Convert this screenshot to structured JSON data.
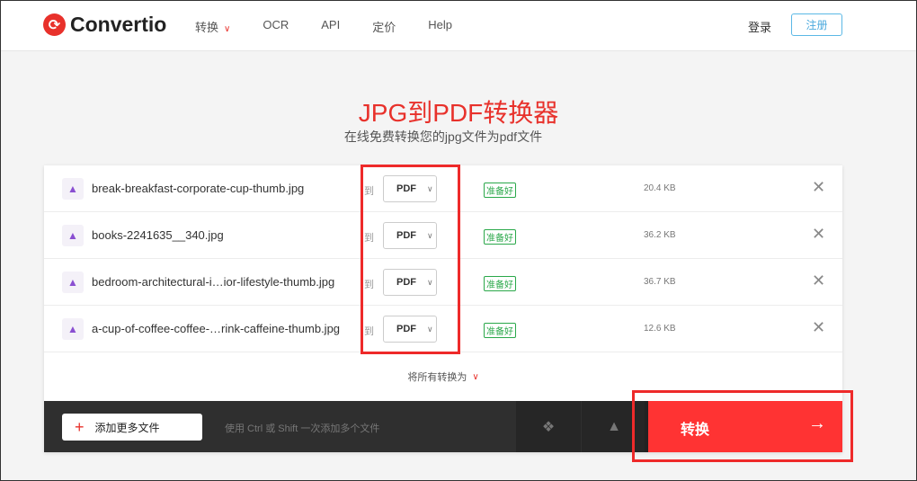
{
  "header": {
    "logo": "Convertio",
    "nav": [
      "转换",
      "OCR",
      "API",
      "定价",
      "Help"
    ],
    "login": "登录",
    "signup": "注册"
  },
  "title": "JPG到PDF转换器",
  "subtitle": "在线免费转换您的jpg文件为pdf文件",
  "to_label": "到",
  "files": [
    {
      "name": "break-breakfast-corporate-cup-thumb.jpg",
      "format": "PDF",
      "status": "准备好",
      "size": "20.4 KB"
    },
    {
      "name": "books-2241635__340.jpg",
      "format": "PDF",
      "status": "准备好",
      "size": "36.2 KB"
    },
    {
      "name": "bedroom-architectural-i…ior-lifestyle-thumb.jpg",
      "format": "PDF",
      "status": "准备好",
      "size": "36.7 KB"
    },
    {
      "name": "a-cup-of-coffee-coffee-…rink-caffeine-thumb.jpg",
      "format": "PDF",
      "status": "准备好",
      "size": "12.6 KB"
    }
  ],
  "convert_all": "将所有转换为",
  "add_more": "添加更多文件",
  "hint": "使用 Ctrl 或 Shift 一次添加多个文件",
  "convert": "转换"
}
